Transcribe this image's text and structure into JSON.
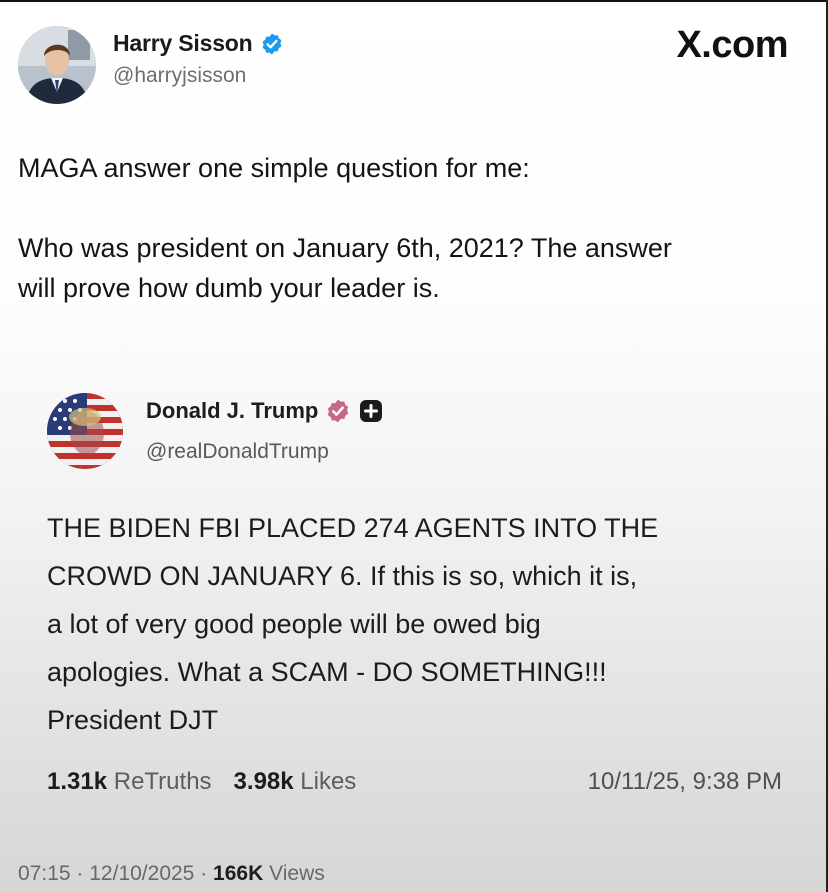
{
  "outer_tweet": {
    "author_name": "Harry Sisson",
    "handle": "@harryjsisson",
    "verified_icon": "blue-check-icon",
    "platform_brand": "X.com",
    "paragraph_1": "MAGA answer one simple question for me:",
    "paragraph_2_line_1": "Who was president on January 6th, 2021? The answer",
    "paragraph_2_line_2": "will prove how dumb your leader is.",
    "time": "07:15",
    "date": "12/10/2025",
    "views_count": "166K",
    "views_label": "Views",
    "separator": "·"
  },
  "quoted_post": {
    "author_name": "Donald J. Trump",
    "handle": "@realDonaldTrump",
    "badges": [
      "pink-verified-icon",
      "plus-badge-icon"
    ],
    "lines": [
      "THE BIDEN FBI PLACED 274 AGENTS INTO THE",
      "CROWD ON JANUARY 6. If this is so, which it is,",
      "a lot of very good people will be owed big",
      "apologies. What a SCAM - DO SOMETHING!!!",
      "President DJT"
    ],
    "retruths_count": "1.31k",
    "retruths_label": "ReTruths",
    "likes_count": "3.98k",
    "likes_label": "Likes",
    "posted_at": "10/11/25, 9:38 PM"
  },
  "colors": {
    "verified_blue": "#1d9bf0",
    "truth_badge_pink": "#c56a86",
    "text_primary": "#141414",
    "text_secondary": "#6b6f73"
  }
}
